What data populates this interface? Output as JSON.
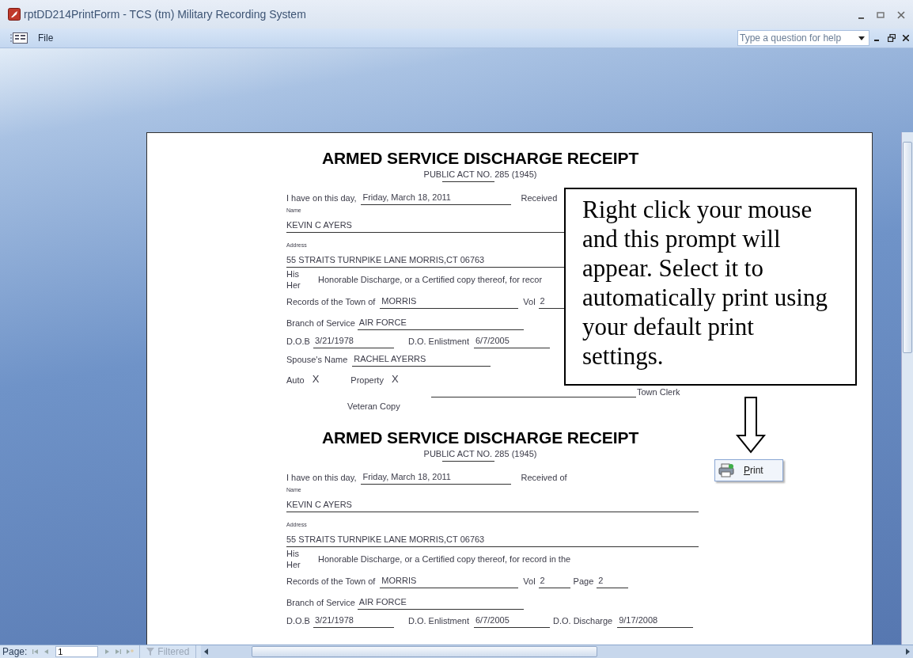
{
  "window": {
    "title": "rptDD214PrintForm - TCS (tm) Military Recording System"
  },
  "menu": {
    "items": [
      "File"
    ],
    "help": {
      "placeholder": "Type a question for help"
    }
  },
  "receipts": [
    {
      "title": "ARMED SERVICE DISCHARGE RECEIPT",
      "act": "PUBLIC ACT NO. 285 (1945)",
      "date_label": "I have on this day,",
      "date": "Friday, March 18, 2011",
      "received": "Received",
      "name_label": "Name",
      "name": "KEVIN C AYERS",
      "address_label": "Address",
      "address": "55 STRAITS TURNPIKE LANE MORRIS,CT 06763",
      "his": "His",
      "her": "Her",
      "discharge_text": "Honorable Discharge, or a Certified copy thereof, for recor",
      "records_label": "Records of the Town of",
      "town": "MORRIS",
      "vol_label": "Vol",
      "vol": "2",
      "branch_label": "Branch of Service",
      "branch": "AIR FORCE",
      "dob_label": "D.O.B",
      "dob": "3/21/1978",
      "enlist_label": "D.O. Enlistment",
      "enlist": "6/7/2005",
      "spouse_label": "Spouse's Name",
      "spouse": "RACHEL AYERRS",
      "auto_label": "Auto",
      "auto": "X",
      "property_label": "Property",
      "property": "X",
      "clerk": "Town Clerk",
      "copy": "Veteran Copy"
    },
    {
      "title": "ARMED SERVICE DISCHARGE RECEIPT",
      "act": "PUBLIC ACT NO. 285 (1945)",
      "date_label": "I have on this day,",
      "date": "Friday, March 18, 2011",
      "received": "Received of",
      "name_label": "Name",
      "name": "KEVIN C AYERS",
      "address_label": "Address",
      "address": "55 STRAITS TURNPIKE LANE MORRIS,CT 06763",
      "his": "His",
      "her": "Her",
      "discharge_text": "Honorable Discharge, or a Certified copy thereof, for record in the",
      "records_label": "Records of the Town of",
      "town": "MORRIS",
      "vol_label": "Vol",
      "vol": "2",
      "page_label": "Page",
      "page": "2",
      "branch_label": "Branch of Service",
      "branch": "AIR FORCE",
      "dob_label": "D.O.B",
      "dob": "3/21/1978",
      "enlist_label": "D.O. Enlistment",
      "enlist": "6/7/2005",
      "discharge_label": "D.O. Discharge",
      "discharge": "9/17/2008"
    }
  ],
  "callout": {
    "text": "Right click your mouse and this prompt will appear. Select it to automatically print using your default print settings."
  },
  "context_menu": {
    "items": [
      "Print"
    ]
  },
  "status_bar": {
    "page_label": "Page:",
    "record": "1",
    "filter": "Filtered"
  }
}
